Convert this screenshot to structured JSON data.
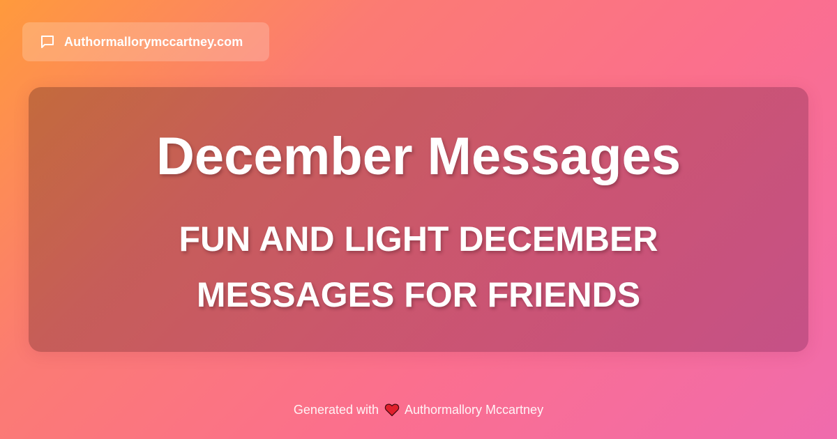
{
  "header": {
    "site_name": "Authormallorymccartney.com",
    "icon": "chat-bubble-icon"
  },
  "card": {
    "title": "December Messages",
    "subtitle": "Fun and Light December Messages for Friends"
  },
  "footer": {
    "prefix": "Generated with",
    "icon": "heart-icon",
    "author": "Authormallory Mccartney"
  },
  "colors": {
    "gradient_start": "#ff9a3c",
    "gradient_mid": "#fb6f8e",
    "gradient_end": "#f06bad",
    "text": "#ffffff",
    "heart": "#e0202c"
  }
}
